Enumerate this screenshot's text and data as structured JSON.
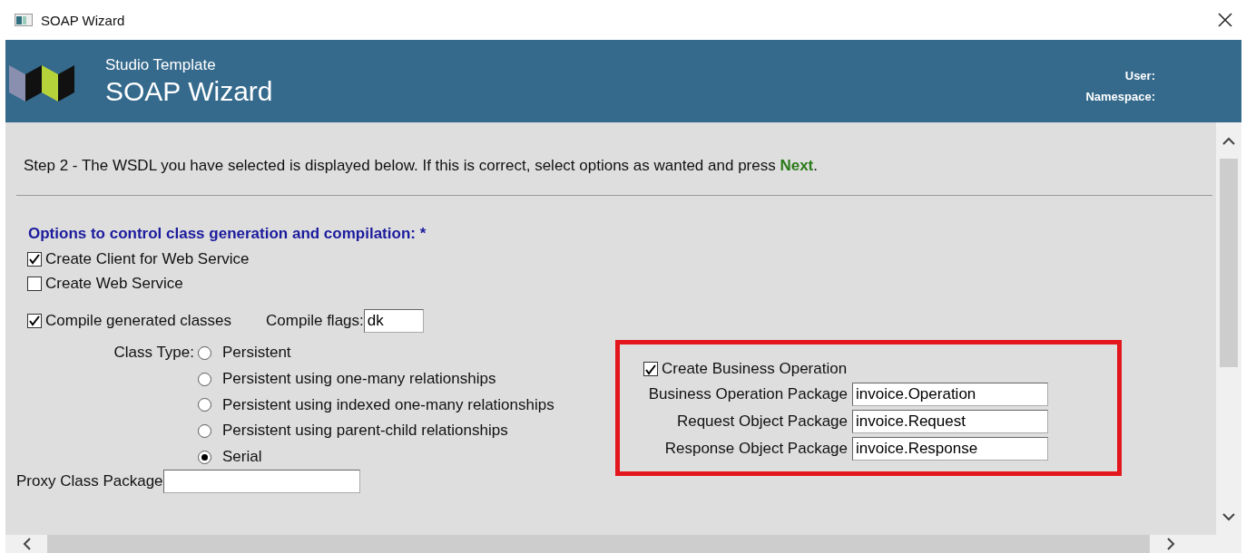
{
  "window": {
    "title": "SOAP Wizard"
  },
  "header": {
    "subtitle": "Studio Template",
    "title": "SOAP Wizard",
    "user_label": "User:",
    "namespace_label": "Namespace:"
  },
  "step": {
    "text": "Step 2 - The WSDL you have selected is displayed below. If this is correct, select options as wanted and press **Next**."
  },
  "options": {
    "heading": "Options to control class generation and compilation: *",
    "checkboxes": [
      {
        "label": "Create Client for Web Service",
        "checked": true
      },
      {
        "label": "Create Web Service",
        "checked": false
      }
    ],
    "compile": {
      "label": "Compile generated classes",
      "checked": true
    },
    "compile_flags": {
      "label": "Compile flags:",
      "value": "dk"
    },
    "class_type": {
      "label": "Class Type:",
      "options": [
        {
          "label": "Persistent",
          "selected": false
        },
        {
          "label": "Persistent using one-many relationships",
          "selected": false
        },
        {
          "label": "Persistent using indexed one-many relationships",
          "selected": false
        },
        {
          "label": "Persistent using parent-child relationships",
          "selected": false
        },
        {
          "label": "Serial",
          "selected": true
        }
      ]
    },
    "proxy_class_package": {
      "label": "Proxy Class Package"
    }
  },
  "business": {
    "create": {
      "label": "Create Business Operation",
      "checked": true
    },
    "fields": [
      {
        "label": "Business Operation Package",
        "value": "invoice.Operation"
      },
      {
        "label": "Request Object Package",
        "value": "invoice.Request"
      },
      {
        "label": "Response Object Package",
        "value": "invoice.Response"
      }
    ]
  }
}
